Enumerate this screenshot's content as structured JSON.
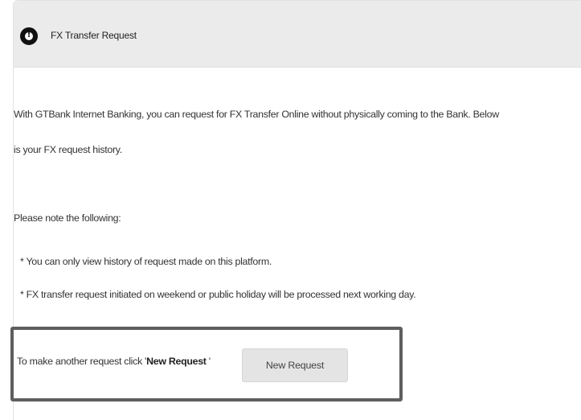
{
  "panel": {
    "title": "FX Transfer Request",
    "icon": "alert-circle-icon"
  },
  "content": {
    "intro_line1": "With GTBank Internet Banking, you can request for FX Transfer Online without physically coming to the Bank. Below",
    "intro_line2": "is your FX request history.",
    "note_heading": "Please note the following:",
    "bullets": [
      "* You can only view history of request made on this platform.",
      "* FX transfer request initiated on weekend or public holiday will be processed next working day."
    ]
  },
  "request": {
    "prompt_prefix": "To make another request click '",
    "prompt_bold": "New Request",
    "prompt_suffix": " '",
    "button_label": "New Request"
  },
  "colors": {
    "header_bg": "#ebebeb",
    "highlight_border": "#5e5e5e",
    "button_bg": "#e4e4e4"
  }
}
